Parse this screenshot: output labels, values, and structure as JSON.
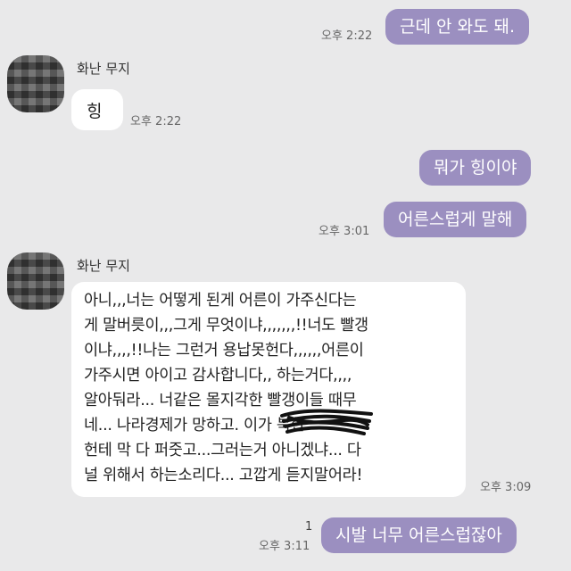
{
  "chat": {
    "messages": [
      {
        "side": "out",
        "text": "근데 안 와도 돼.",
        "time": "오후 2:22"
      },
      {
        "side": "in",
        "sender": "화난 무지",
        "text": "힝",
        "time": "오후 2:22"
      },
      {
        "side": "out",
        "text": "뭐가 힝이야"
      },
      {
        "side": "out",
        "text": "어른스럽게 말해",
        "time": "오후 3:01"
      },
      {
        "side": "in",
        "sender": "화난 무지",
        "lines": [
          "아니,,,너는 어떻게 된게 어른이 가주신다는",
          "게 말버릇이,,,그게 무엇이냐,,,,,,,!!너도 빨갱",
          "이냐,,,,!!나는 그런거 용납못헌다,,,,,,어른이",
          "가주시면 아이고 감사합니다,, 하는거다,,,,",
          "알아둬라... 너같은 몰지각한 빨갱이들 때무",
          "네... 나라경제가 망하고.           이가 북한",
          "헌테 막 다 퍼줏고...그러는거 아니겠냐... 다",
          "널 위해서 하는소리다... 고깝게 듣지말어라!"
        ],
        "time": "오후 3:09"
      },
      {
        "side": "out",
        "text": "시발 너무 어른스럽잖아",
        "time": "오후 3:11",
        "unread": "1"
      }
    ]
  }
}
